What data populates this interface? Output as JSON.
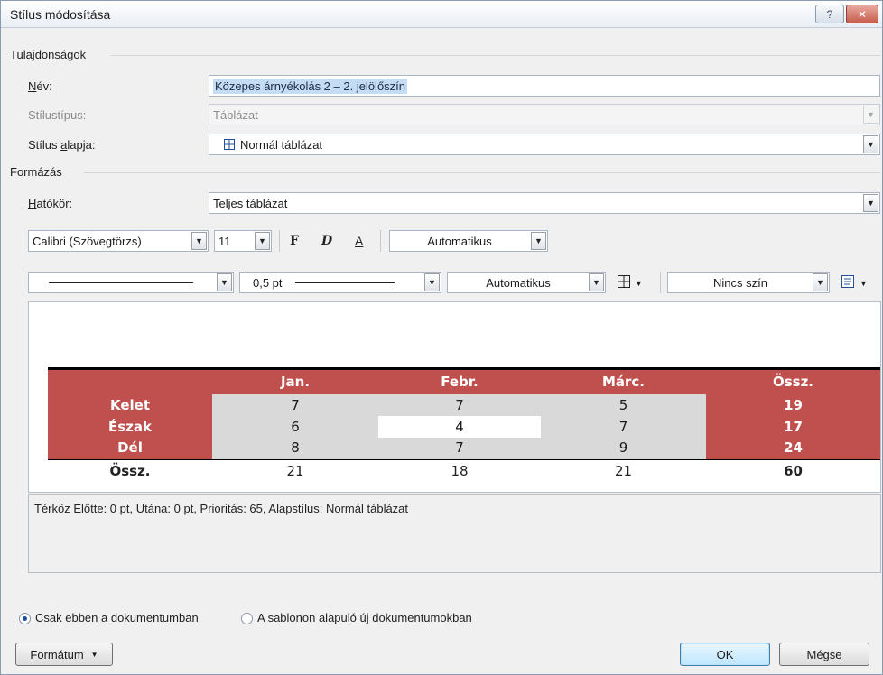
{
  "window": {
    "title": "Stílus módosítása",
    "help_glyph": "?",
    "close_glyph": "✕"
  },
  "properties": {
    "section_title": "Tulajdonságok",
    "name_label": "Név:",
    "name_value": "Közepes árnyékolás 2 – 2. jelölőszín",
    "type_label": "Stílustípus:",
    "type_value": "Táblázat",
    "based_label": "Stílus alapja:",
    "based_value": "Normál táblázat"
  },
  "formatting": {
    "section_title": "Formázás",
    "scope_label": "Hatókör:",
    "scope_value": "Teljes táblázat",
    "font": "Calibri (Szövegtörzs)",
    "size": "11",
    "bold": "F",
    "italic": "D",
    "underline": "A",
    "font_color": "Automatikus",
    "line_weight": "0,5 pt",
    "line_color": "Automatikus",
    "fill": "Nincs szín"
  },
  "preview": {
    "columns": [
      "",
      "Jan.",
      "Febr.",
      "Márc.",
      "Össz."
    ],
    "rows": [
      {
        "label": "Kelet",
        "values": [
          "7",
          "7",
          "5"
        ],
        "total": "19"
      },
      {
        "label": "Észak",
        "values": [
          "6",
          "4",
          "7"
        ],
        "total": "17"
      },
      {
        "label": "Dél",
        "values": [
          "8",
          "7",
          "9"
        ],
        "total": "24"
      }
    ],
    "summary": {
      "label": "Össz.",
      "values": [
        "21",
        "18",
        "21"
      ],
      "total": "60"
    }
  },
  "description": "Térköz Előtte:  0 pt, Utána:  0 pt, Prioritás: 65, Alapstílus: Normál táblázat",
  "options": {
    "only_doc": "Csak ebben a dokumentumban",
    "template_docs": "A sablonon alapuló új dokumentumokban"
  },
  "buttons": {
    "format": "Formátum",
    "ok": "OK",
    "cancel": "Mégse"
  },
  "colors": {
    "accent": "#c0504d",
    "band": "#d9d9d9"
  }
}
